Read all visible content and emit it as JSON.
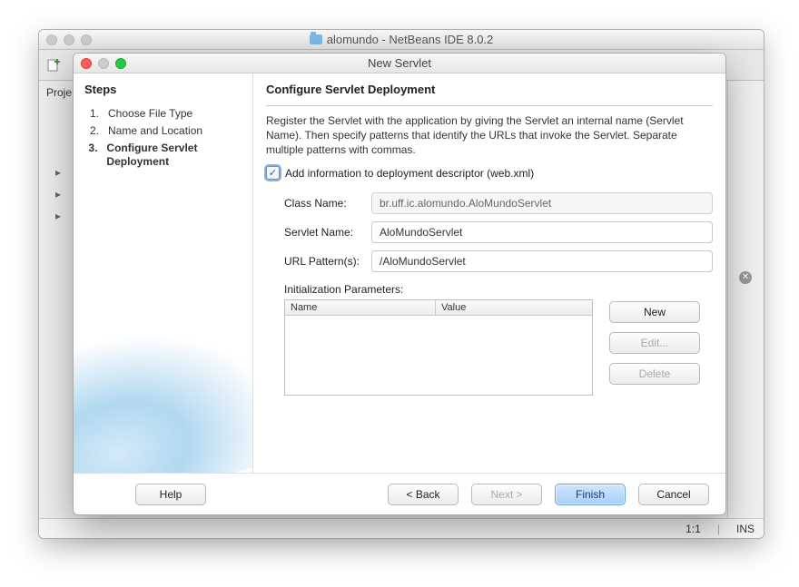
{
  "main_window": {
    "title": "alomundo - NetBeans IDE 8.0.2",
    "projects_label": "Proje"
  },
  "dialog": {
    "title": "New Servlet",
    "steps_heading": "Steps",
    "steps": [
      {
        "num": "1.",
        "label": "Choose File Type"
      },
      {
        "num": "2.",
        "label": "Name and Location"
      },
      {
        "num": "3.",
        "label": "Configure Servlet Deployment"
      }
    ],
    "content": {
      "heading": "Configure Servlet Deployment",
      "description": "Register the Servlet with the application by giving the Servlet an internal name (Servlet Name). Then specify patterns that identify the URLs that invoke the Servlet. Separate multiple patterns with commas.",
      "checkbox_label": "Add information to deployment descriptor (web.xml)",
      "class_name_label": "Class Name:",
      "class_name_value": "br.uff.ic.alomundo.AloMundoServlet",
      "servlet_name_label": "Servlet Name:",
      "servlet_name_value": "AloMundoServlet",
      "url_pattern_label": "URL Pattern(s):",
      "url_pattern_value": "/AloMundoServlet",
      "init_params_label": "Initialization Parameters:",
      "table_headers": {
        "name": "Name",
        "value": "Value"
      },
      "buttons": {
        "new": "New",
        "edit": "Edit...",
        "delete": "Delete"
      }
    },
    "footer": {
      "help": "Help",
      "back": "< Back",
      "next": "Next >",
      "finish": "Finish",
      "cancel": "Cancel"
    }
  },
  "statusbar": {
    "pos": "1:1",
    "ins": "INS"
  }
}
